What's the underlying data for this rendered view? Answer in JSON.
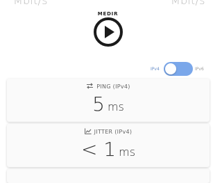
{
  "header": {
    "left_unit": "Mbit/s",
    "right_unit": "Mbit/s"
  },
  "measure": {
    "label": "MEDIR",
    "icon": "play-icon"
  },
  "ip_toggle": {
    "left_label": "IPv4",
    "right_label": "IPv6",
    "state": "IPv4",
    "accent_color": "#7aa7ea"
  },
  "cards": {
    "ping": {
      "icon": "swap-arrows-icon",
      "title": "PING (IPv4)",
      "value": "5",
      "unit": "ms"
    },
    "jitter": {
      "icon": "line-chart-icon",
      "title": "JITTER (IPv4)",
      "value": "< 1",
      "unit": "ms"
    }
  }
}
